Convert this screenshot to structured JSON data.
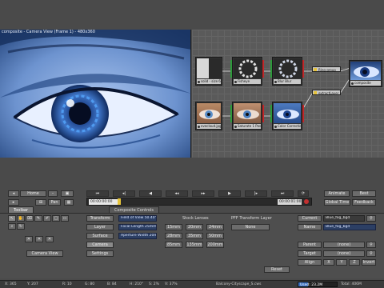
{
  "viewer": {
    "title": "composite - Camera View (Frame 1) - 480x360"
  },
  "graph": {
    "nodes": [
      {
        "name": "solid-node",
        "label": "solid - size 60"
      },
      {
        "name": "fisheye-node",
        "label": "Fisheye"
      },
      {
        "name": "blur-node",
        "label": "Blur Blur"
      },
      {
        "name": "ring-node",
        "label": "Ring group"
      },
      {
        "name": "composite-node",
        "label": "composite"
      },
      {
        "name": "eye-node",
        "label": "evecloud.jpg"
      },
      {
        "name": "balance-node",
        "label": "Saturate 1 Poster"
      },
      {
        "name": "color-node",
        "label": "Color Correction"
      },
      {
        "name": "extract-node",
        "label": "extractLayer"
      }
    ]
  },
  "toolbar": {
    "home": "Home",
    "pan": "Pan",
    "animate": "Animate",
    "best": "Best",
    "global_time": "Global Time",
    "feedback": "Feedback",
    "time_in": "00:00:00:00",
    "time_out": "00:00:01:00"
  },
  "tabs": [
    "Toolbar",
    "Composite Controls"
  ],
  "left_panel": {
    "camera_view": "Camera View"
  },
  "controls": {
    "buttons": [
      "Transform",
      "Layer",
      "Surface",
      "Camera",
      "Settings"
    ],
    "fov": "Field of View 50.40°",
    "focal": "Focal Length 25mm",
    "aperture": "Aperture Width 20mm",
    "stock_title": "Stock Lenses",
    "lenses": [
      "15mm",
      "20mm",
      "24mm",
      "28mm",
      "35mm",
      "50mm",
      "85mm",
      "135mm",
      "200mm"
    ],
    "xform_title": "PFF Transform Layer",
    "xform_value": "None",
    "reset": "Reset"
  },
  "right_panel": {
    "current_label": "Current",
    "current_value": "Blue_fog_bgd",
    "name_label": "Name",
    "name_value": "Blue_fog_bgd",
    "parent_label": "Parent",
    "parent_value": "(none)",
    "target_label": "Target",
    "target_value": "(none)",
    "align_label": "Align",
    "align_opts": [
      "X",
      "Y",
      "Z",
      "Invert"
    ]
  },
  "status": {
    "x": "X: 365",
    "y": "Y: 207",
    "r": "R: 10",
    "g": "G: 80",
    "b": "B: 84",
    "h": "H: 210°",
    "s": "S: 2%",
    "v": "V: 37%",
    "file": "Balcony-Cityscape_S.cws",
    "used": "Used: 23.2M",
    "total": "Total: 406M",
    "mem_fraction": 0.25
  },
  "colors": {
    "viewer_bg": "#3c6bb0",
    "field_bg": "#2c3f64",
    "accent": "#e6c43a"
  }
}
